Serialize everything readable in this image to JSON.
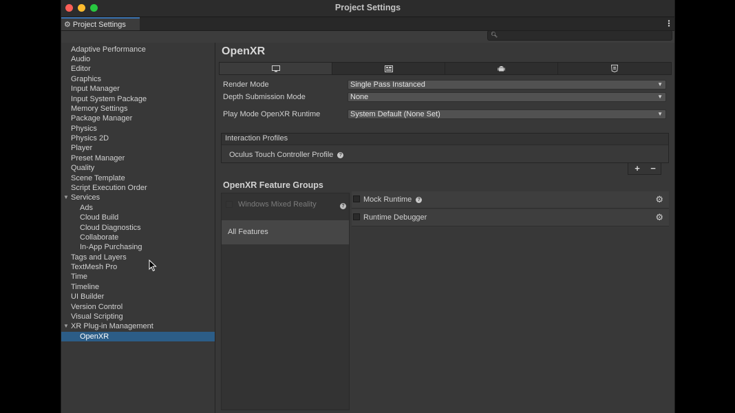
{
  "window": {
    "title": "Project Settings"
  },
  "tab": {
    "label": "Project Settings",
    "icon": "gear-icon"
  },
  "search": {
    "placeholder": ""
  },
  "sidebar": {
    "items": [
      {
        "label": "Adaptive Performance"
      },
      {
        "label": "Audio"
      },
      {
        "label": "Editor"
      },
      {
        "label": "Graphics"
      },
      {
        "label": "Input Manager"
      },
      {
        "label": "Input System Package"
      },
      {
        "label": "Memory Settings"
      },
      {
        "label": "Package Manager"
      },
      {
        "label": "Physics"
      },
      {
        "label": "Physics 2D"
      },
      {
        "label": "Player"
      },
      {
        "label": "Preset Manager"
      },
      {
        "label": "Quality"
      },
      {
        "label": "Scene Template"
      },
      {
        "label": "Script Execution Order"
      },
      {
        "label": "Services"
      },
      {
        "label": "Ads"
      },
      {
        "label": "Cloud Build"
      },
      {
        "label": "Cloud Diagnostics"
      },
      {
        "label": "Collaborate"
      },
      {
        "label": "In-App Purchasing"
      },
      {
        "label": "Tags and Layers"
      },
      {
        "label": "TextMesh Pro"
      },
      {
        "label": "Time"
      },
      {
        "label": "Timeline"
      },
      {
        "label": "UI Builder"
      },
      {
        "label": "Version Control"
      },
      {
        "label": "Visual Scripting"
      },
      {
        "label": "XR Plug-in Management"
      },
      {
        "label": "OpenXR"
      }
    ]
  },
  "main": {
    "title": "OpenXR",
    "platform_tabs": [
      {
        "icon": "desktop-icon"
      },
      {
        "icon": "universal-windows-icon"
      },
      {
        "icon": "android-icon"
      },
      {
        "icon": "webgl-icon"
      }
    ],
    "render_mode": {
      "label": "Render Mode",
      "value": "Single Pass Instanced"
    },
    "depth_submission": {
      "label": "Depth Submission Mode",
      "value": "None"
    },
    "play_mode_runtime": {
      "label": "Play Mode OpenXR Runtime",
      "value": "System Default (None Set)"
    },
    "interaction_profiles": {
      "header": "Interaction Profiles",
      "items": [
        {
          "label": "Oculus Touch Controller Profile"
        }
      ],
      "add": "+",
      "remove": "−"
    },
    "feature_groups": {
      "title": "OpenXR Feature Groups",
      "groups": [
        {
          "label": "Windows Mixed Reality",
          "enabled": false
        },
        {
          "label": "All Features",
          "selected": true
        }
      ],
      "features": [
        {
          "label": "Mock Runtime",
          "checked": false,
          "help": true
        },
        {
          "label": "Runtime Debugger",
          "checked": false,
          "help": false
        }
      ]
    }
  }
}
